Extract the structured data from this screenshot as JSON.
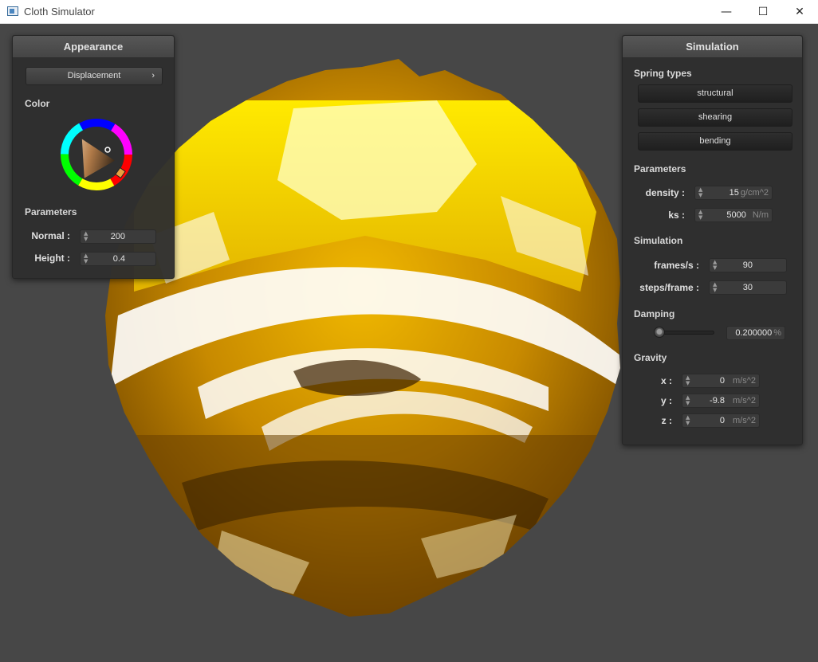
{
  "window": {
    "title": "Cloth Simulator",
    "minimize_glyph": "—",
    "maximize_glyph": "☐",
    "close_glyph": "✕"
  },
  "appearance": {
    "title": "Appearance",
    "shader_button": "Displacement",
    "shader_chevron": "›",
    "color_label": "Color",
    "params_label": "Parameters",
    "normal_label": "Normal :",
    "normal_value": "200",
    "height_label": "Height :",
    "height_value": "0.4"
  },
  "simulation": {
    "title": "Simulation",
    "spring_types_label": "Spring types",
    "spring_buttons": [
      "structural",
      "shearing",
      "bending"
    ],
    "params_label": "Parameters",
    "density_label": "density :",
    "density_value": "15",
    "density_unit": "g/cm^2",
    "ks_label": "ks :",
    "ks_value": "5000",
    "ks_unit": "N/m",
    "sim_label": "Simulation",
    "fps_label": "frames/s :",
    "fps_value": "90",
    "steps_label": "steps/frame :",
    "steps_value": "30",
    "damping_label": "Damping",
    "damping_level": 0.002,
    "damping_value": "0.200000",
    "damping_unit": "%",
    "gravity_label": "Gravity",
    "gx_label": "x :",
    "gx_value": "0",
    "gy_label": "y :",
    "gy_value": "-9.8",
    "gz_label": "z :",
    "gz_value": "0",
    "gravity_unit": "m/s^2"
  },
  "colors": {
    "panel_bg": "#2e2e2e",
    "viewport_bg": "#474747",
    "cloth_gold": "#c88a00",
    "cloth_yellow": "#ffe600",
    "cloth_dark": "#4a2c00"
  },
  "icons": {
    "app": "window-app-icon",
    "spin": "spinner-arrows-icon",
    "chevron": "chevron-right-icon"
  }
}
